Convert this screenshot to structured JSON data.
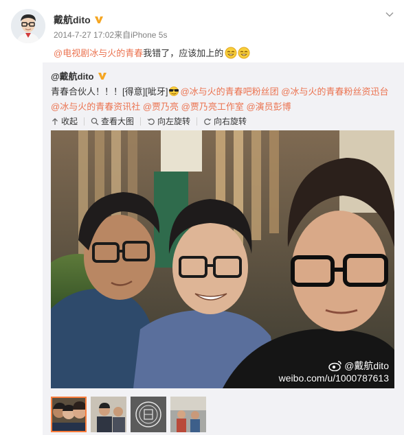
{
  "post": {
    "username": "戴航dito",
    "meta": "2014-7-27 17:02来自iPhone 5s",
    "text_mention": "@电视剧冰与火的青春",
    "text_body": " 我错了，应该加上的",
    "emoji": "grin-emoji"
  },
  "repost": {
    "username": "@戴航dito",
    "text_parts": [
      {
        "t": "青春合伙人！！！[得意][呲牙]",
        "m": false
      },
      {
        "t": "@冰与火的青春吧粉丝团",
        "m": true
      },
      {
        "t": " ",
        "m": false
      },
      {
        "t": "@冰与火的青春粉丝资迅台",
        "m": true
      },
      {
        "t": " ",
        "m": false
      },
      {
        "t": "@冰与火的青春资讯社",
        "m": true
      },
      {
        "t": " ",
        "m": false
      },
      {
        "t": "@贾乃亮",
        "m": true
      },
      {
        "t": " ",
        "m": false
      },
      {
        "t": "@贾乃亮工作室",
        "m": true
      },
      {
        "t": " ",
        "m": false
      },
      {
        "t": "@演员彭博",
        "m": true
      }
    ],
    "actions": [
      "收起",
      "查看大图",
      "向左旋转",
      "向右旋转"
    ],
    "watermark_user": "@戴航dito",
    "watermark_url": "weibo.com/u/1000787613"
  },
  "colors": {
    "mention": "#eb7350",
    "repost_bg": "#f2f2f5",
    "thumb_active": "#fa7d3c",
    "vip": "#f5a623"
  }
}
